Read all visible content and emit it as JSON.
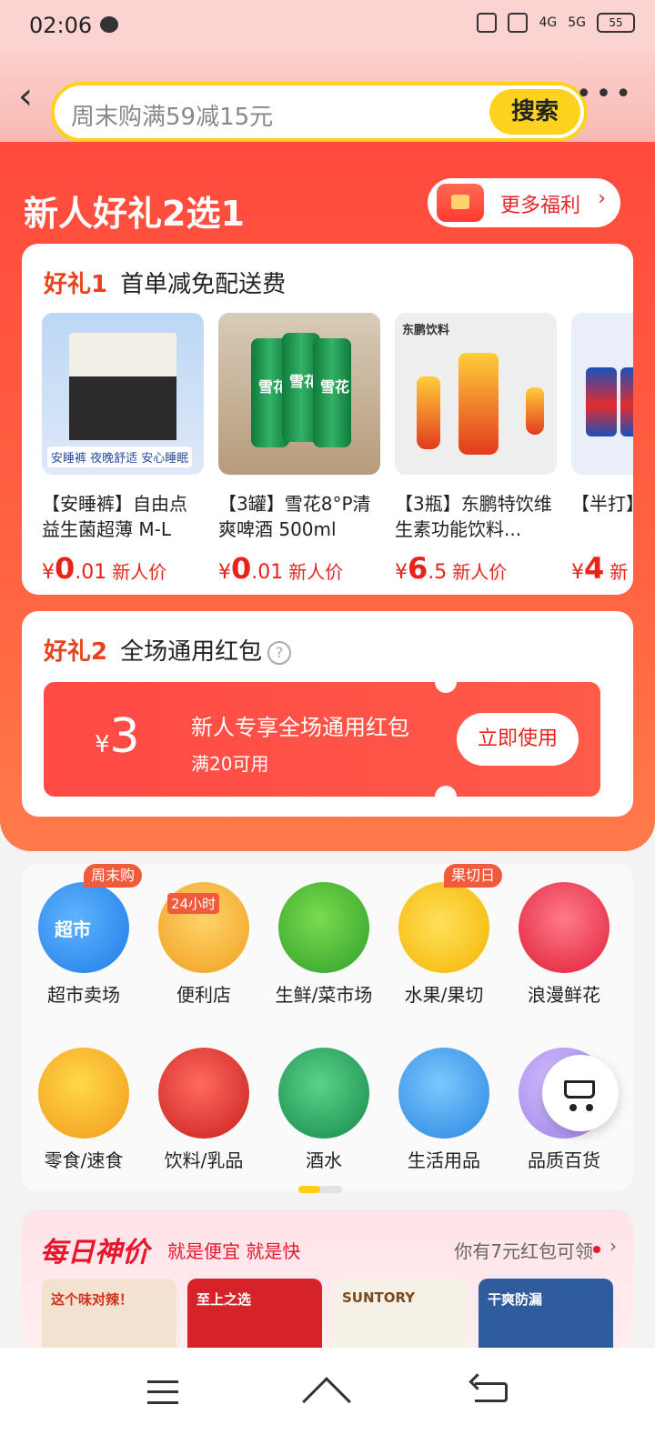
{
  "status_bar": {
    "time": "02:06",
    "battery": "55",
    "network_1": "4G",
    "network_2": "5G"
  },
  "search": {
    "placeholder": "周末购满59减15元",
    "button": "搜索"
  },
  "promo": {
    "title": "新人好礼2选1",
    "more_welfare": "更多福利",
    "gift1": {
      "num": "好礼1",
      "desc": "首单减免配送费",
      "products": [
        {
          "name": "【安睡裤】自由点益生菌超薄 M-L码...",
          "price_symbol": "¥",
          "price_int": "0",
          "price_dec": ".01",
          "tag": "新人价",
          "img_label": "安睡裤 夜晚舒适 安心睡眠"
        },
        {
          "name": "【3罐】雪花8°P清爽啤酒 500ml",
          "price_symbol": "¥",
          "price_int": "0",
          "price_dec": ".01",
          "tag": "新人价",
          "img_label": "雪花"
        },
        {
          "name": "【3瓶】东鹏特饮维生素功能饮料...",
          "price_symbol": "¥",
          "price_int": "6",
          "price_dec": ".5",
          "tag": "新人价",
          "img_label": "东鹏饮料"
        },
        {
          "name": "【半打】可乐 汽水",
          "price_symbol": "¥",
          "price_int": "4",
          "price_dec": "",
          "tag": "新",
          "img_label": "pepsi"
        }
      ]
    },
    "gift2": {
      "num": "好礼2",
      "desc": "全场通用红包",
      "help": "?",
      "coupon": {
        "currency": "¥",
        "amount": "3",
        "title": "新人专享全场通用红包",
        "condition": "满20可用",
        "use_button": "立即使用"
      }
    }
  },
  "categories": [
    {
      "label": "超市卖场",
      "badge": "周末购",
      "icon": "supermarket-icon"
    },
    {
      "label": "便利店",
      "badge": "",
      "icon": "convenience-store-icon"
    },
    {
      "label": "生鲜/菜市场",
      "badge": "",
      "icon": "vegetable-icon"
    },
    {
      "label": "水果/果切",
      "badge": "果切日",
      "icon": "fruit-icon"
    },
    {
      "label": "浪漫鲜花",
      "badge": "",
      "icon": "flower-icon"
    },
    {
      "label": "零食/速食",
      "badge": "",
      "icon": "snack-icon"
    },
    {
      "label": "饮料/乳品",
      "badge": "",
      "icon": "drink-icon"
    },
    {
      "label": "酒水",
      "badge": "",
      "icon": "beer-icon"
    },
    {
      "label": "生活用品",
      "badge": "",
      "icon": "detergent-icon"
    },
    {
      "label": "品质百货",
      "badge": "",
      "icon": "phone-icon"
    }
  ],
  "store_labels": {
    "convenience": "24小时",
    "supermarket": "超市"
  },
  "daily": {
    "logo": "每日神价",
    "slogan": "就是便宜 就是快",
    "redpacket_text": "你有7元红包可领",
    "thumbs": [
      "这个味对辣！",
      "至上之选",
      "SUNTORY",
      "干爽防漏"
    ]
  },
  "colors": {
    "accent_red": "#ff4a3d",
    "price_red": "#e8231a",
    "search_yellow": "#ffd21f"
  }
}
